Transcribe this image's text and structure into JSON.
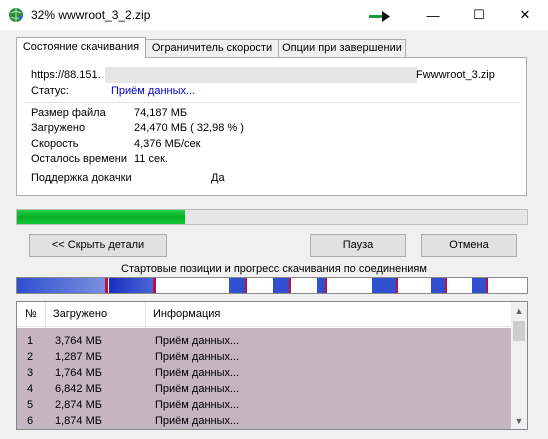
{
  "window": {
    "title": "32% wwwroot_3_2.zip",
    "icon": "idm-globe-icon",
    "minimize_glyph": "—",
    "maximize_glyph": "☐",
    "close_glyph": "✕"
  },
  "tabs": [
    {
      "label": "Состояние скачивания",
      "active": true
    },
    {
      "label": "Ограничитель скорости",
      "active": false
    },
    {
      "label": "Опции при завершении",
      "active": false
    }
  ],
  "info": {
    "url_prefix": "https://88.151.",
    "url_suffix": "Fwwwroot_3.zip",
    "status_label": "Статус:",
    "status_value": "Приём данных...",
    "file_size_label": "Размер файла",
    "file_size_value": "74,187  МБ",
    "downloaded_label": "Загружено",
    "downloaded_value": "24,470  МБ  ( 32,98 % )",
    "speed_label": "Скорость",
    "speed_value": "4,376  МБ/сек",
    "time_left_label": "Осталось времени",
    "time_left_value": "11 сек.",
    "resume_label": "Поддержка докачки",
    "resume_value": "Да"
  },
  "progress": {
    "percent": 32.98,
    "color": "#06b025"
  },
  "buttons": {
    "details": "<< Скрыть детали",
    "pause": "Пауза",
    "cancel": "Отмена"
  },
  "connections": {
    "caption": "Стартовые позиции и прогресс скачивания по соединениям",
    "segment_colors": [
      "#1a2fbf",
      "#c01040",
      "#6a8cd8"
    ]
  },
  "table": {
    "columns": [
      "№",
      "Загружено",
      "Информация"
    ],
    "rows": [
      {
        "n": "1",
        "downloaded": "3,764  МБ",
        "info": "Приём данных..."
      },
      {
        "n": "2",
        "downloaded": "1,287  МБ",
        "info": "Приём данных..."
      },
      {
        "n": "3",
        "downloaded": "1,764  МБ",
        "info": "Приём данных..."
      },
      {
        "n": "4",
        "downloaded": "6,842  МБ",
        "info": "Приём данных..."
      },
      {
        "n": "5",
        "downloaded": "2,874  МБ",
        "info": "Приём данных..."
      },
      {
        "n": "6",
        "downloaded": "1,874  МБ",
        "info": "Приём данных..."
      }
    ],
    "row_background": "#c4b5c1"
  },
  "scrollbar": {
    "up_glyph": "▲",
    "down_glyph": "▼"
  }
}
